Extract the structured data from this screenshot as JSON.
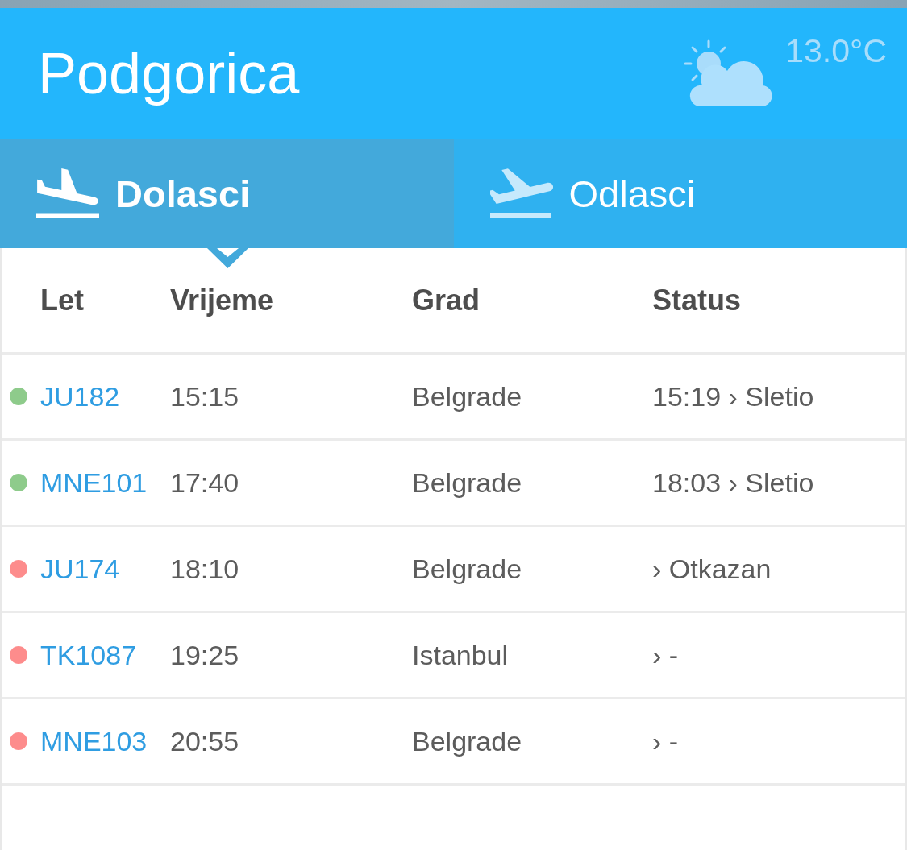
{
  "header": {
    "city": "Podgorica",
    "temperature": "13.0°C"
  },
  "tabs": [
    {
      "label": "Dolasci",
      "kind": "arrivals",
      "selected": true
    },
    {
      "label": "Odlasci",
      "kind": "departures",
      "selected": false
    }
  ],
  "table": {
    "columns": [
      "Let",
      "Vrijeme",
      "Grad",
      "Status"
    ],
    "rows": [
      {
        "color": "#8ecb8b",
        "flight": "JU182",
        "time": "15:15",
        "city": "Belgrade",
        "status": "15:19 › Sletio"
      },
      {
        "color": "#8ecb8b",
        "flight": "MNE101",
        "time": "17:40",
        "city": "Belgrade",
        "status": "18:03 › Sletio"
      },
      {
        "color": "#fd8c8c",
        "flight": "JU174",
        "time": "18:10",
        "city": "Belgrade",
        "status": "› Otkazan"
      },
      {
        "color": "#fd8c8c",
        "flight": "TK1087",
        "time": "19:25",
        "city": "Istanbul",
        "status": "› -"
      },
      {
        "color": "#fd8c8c",
        "flight": "MNE103",
        "time": "20:55",
        "city": "Belgrade",
        "status": "› -"
      }
    ]
  }
}
